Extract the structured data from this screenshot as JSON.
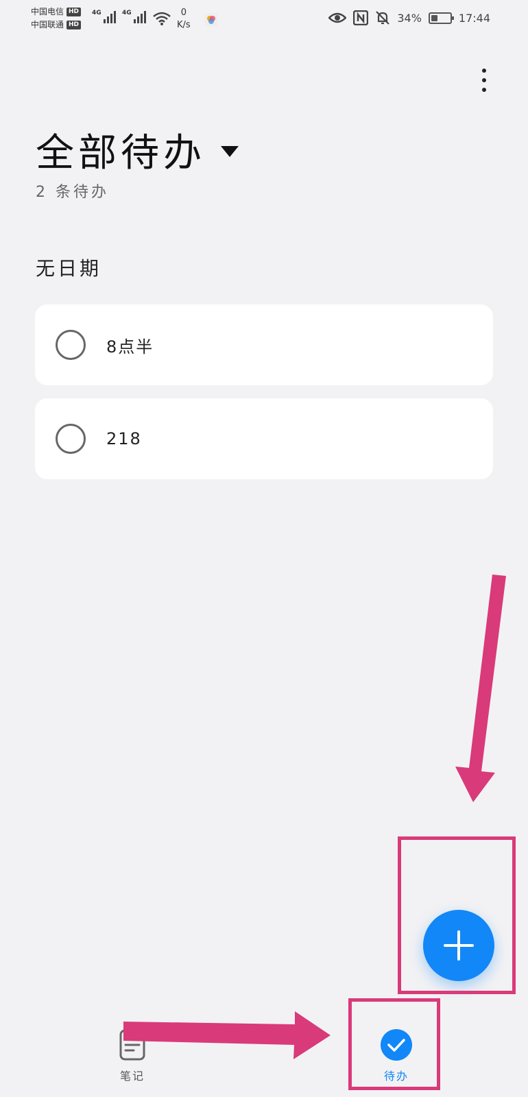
{
  "status_bar": {
    "carrier_1": "中国电信",
    "carrier_2": "中国联通",
    "hd_label": "HD",
    "network_1": "4G",
    "network_2": "4G",
    "speed_value": "0",
    "speed_unit": "K/s",
    "battery_percent": "34%",
    "battery_level": 0.34,
    "time": "17:44"
  },
  "header": {
    "title": "全部待办",
    "subtitle": "2 条待办"
  },
  "section": {
    "title": "无日期"
  },
  "todos": [
    {
      "text": "8点半",
      "done": false
    },
    {
      "text": "218",
      "done": false
    }
  ],
  "bottom_nav": {
    "notes_label": "笔记",
    "todo_label": "待办",
    "active": "todo"
  },
  "colors": {
    "accent": "#1287f7",
    "background": "#f2f2f4",
    "annotation": "#d93a7a"
  },
  "icons": [
    "eye-icon",
    "nfc-icon",
    "bell-off-icon",
    "battery-icon",
    "wifi-icon",
    "signal-icon",
    "more-vertical-icon",
    "plus-icon",
    "notes-icon",
    "check-icon"
  ]
}
